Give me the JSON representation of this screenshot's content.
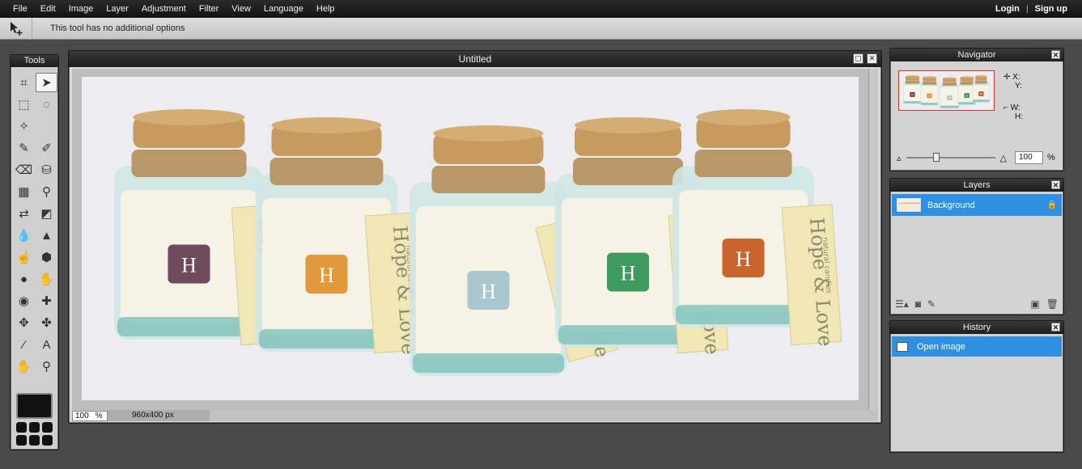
{
  "menu": [
    "File",
    "Edit",
    "Image",
    "Layer",
    "Adjustment",
    "Filter",
    "View",
    "Language",
    "Help"
  ],
  "auth": {
    "login": "Login",
    "separator": "|",
    "signup": "Sign up"
  },
  "options": {
    "text": "This tool has no additional options"
  },
  "tools": {
    "title": "Tools",
    "items": [
      {
        "name": "crop-tool",
        "glyph": "⌗"
      },
      {
        "name": "move-tool",
        "glyph": "➤"
      },
      {
        "name": "marquee-tool",
        "glyph": "⬚"
      },
      {
        "name": "lasso-tool",
        "glyph": "◌"
      },
      {
        "name": "magic-wand-tool",
        "glyph": "✧"
      },
      {
        "name": "blank-tool",
        "glyph": ""
      },
      {
        "name": "pencil-tool",
        "glyph": "✎"
      },
      {
        "name": "brush-tool",
        "glyph": "✐"
      },
      {
        "name": "eraser-tool",
        "glyph": "⌫"
      },
      {
        "name": "paint-bucket-tool",
        "glyph": "⛁"
      },
      {
        "name": "gradient-tool",
        "glyph": "▦"
      },
      {
        "name": "clone-stamp-tool",
        "glyph": "⚲"
      },
      {
        "name": "color-replace-tool",
        "glyph": "⇄"
      },
      {
        "name": "draw-tool",
        "glyph": "◩"
      },
      {
        "name": "blur-tool",
        "glyph": "💧"
      },
      {
        "name": "sharpen-tool",
        "glyph": "▲"
      },
      {
        "name": "smudge-tool",
        "glyph": "☝"
      },
      {
        "name": "sponge-tool",
        "glyph": "⬢"
      },
      {
        "name": "dodge-tool",
        "glyph": "●"
      },
      {
        "name": "burn-tool",
        "glyph": "✋"
      },
      {
        "name": "red-eye-tool",
        "glyph": "◉"
      },
      {
        "name": "spot-heal-tool",
        "glyph": "✚"
      },
      {
        "name": "bloat-tool",
        "glyph": "✥"
      },
      {
        "name": "pinch-tool",
        "glyph": "✤"
      },
      {
        "name": "color-picker-tool",
        "glyph": "⁄"
      },
      {
        "name": "type-tool",
        "glyph": "A"
      },
      {
        "name": "hand-tool",
        "glyph": "✋"
      },
      {
        "name": "zoom-tool",
        "glyph": "⚲"
      }
    ]
  },
  "document": {
    "title": "Untitled",
    "zoom": "100",
    "zoom_unit": "%",
    "dimensions": "960x400 px"
  },
  "image": {
    "tag_text": "Hope & Love",
    "tag_sub": "natural candles",
    "jars": [
      {
        "label_color": "#6e4a5c"
      },
      {
        "label_color": "#e09a3c"
      },
      {
        "label_color": "#a9c7cf"
      },
      {
        "label_color": "#3e9a5e"
      },
      {
        "label_color": "#c8642c"
      }
    ]
  },
  "navigator": {
    "title": "Navigator",
    "x_label": "X:",
    "y_label": "Y:",
    "w_label": "W:",
    "h_label": "H:",
    "zoom_value": "100",
    "zoom_unit": "%",
    "zoom_level": 0.3
  },
  "layers": {
    "title": "Layers",
    "items": [
      {
        "name": "Background",
        "locked": true
      }
    ]
  },
  "history": {
    "title": "History",
    "items": [
      {
        "label": "Open image"
      }
    ]
  }
}
